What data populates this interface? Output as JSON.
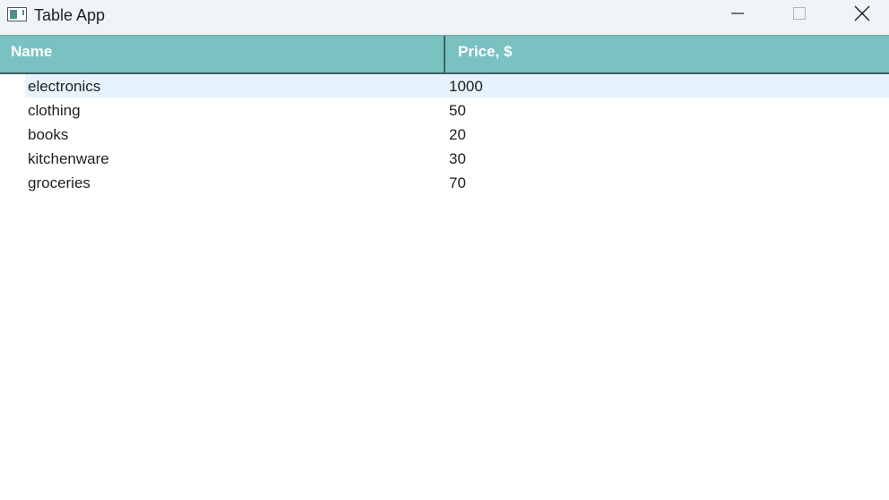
{
  "window": {
    "title": "Table App"
  },
  "icons": {
    "app": "app-icon",
    "minimize": "minimize-icon",
    "maximize": "maximize-icon",
    "close": "close-icon"
  },
  "table": {
    "columns": [
      "Name",
      "Price, $"
    ],
    "rows": [
      {
        "name": "electronics",
        "price": "1000",
        "selected": true
      },
      {
        "name": "clothing",
        "price": "50",
        "selected": false
      },
      {
        "name": "books",
        "price": "20",
        "selected": false
      },
      {
        "name": "kitchenware",
        "price": "30",
        "selected": false
      },
      {
        "name": "groceries",
        "price": "70",
        "selected": false
      }
    ]
  },
  "colors": {
    "titlebar": "#eff4f6",
    "header": "#79c2c1",
    "header_border": "#3f5f5e",
    "selected_row": "#e6f3fd"
  }
}
